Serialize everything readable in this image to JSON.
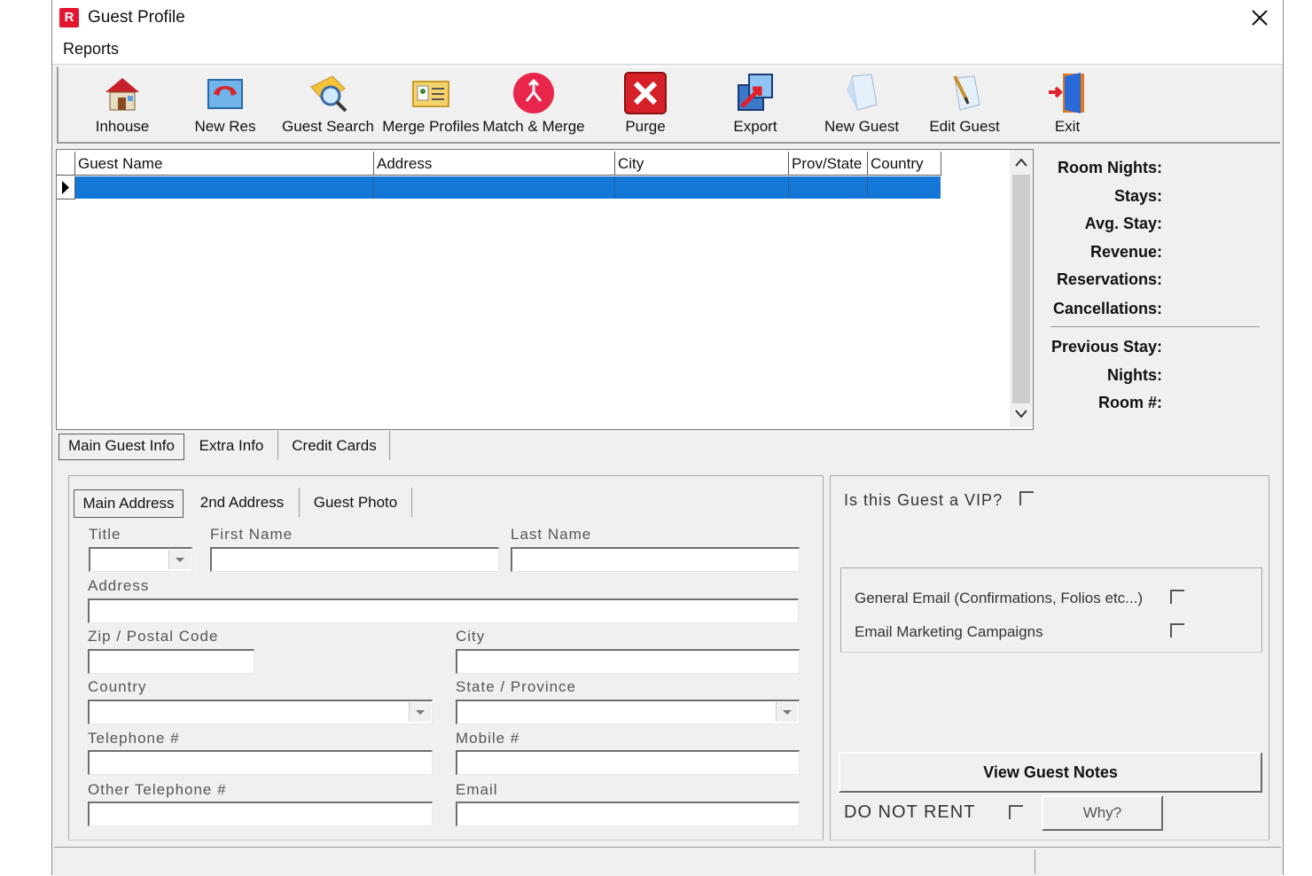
{
  "window": {
    "title": "Guest Profile",
    "logo_letter": "R"
  },
  "menu": {
    "reports": "Reports"
  },
  "toolbar": {
    "inhouse": "Inhouse",
    "new_res": "New Res",
    "guest_search": "Guest Search",
    "merge_profiles": "Merge Profiles",
    "match_merge": "Match & Merge",
    "purge": "Purge",
    "export": "Export",
    "new_guest": "New Guest",
    "edit_guest": "Edit Guest",
    "exit": "Exit"
  },
  "grid": {
    "columns": [
      "Guest Name",
      "Address",
      "City",
      "Prov/State",
      "Country"
    ]
  },
  "stats": {
    "room_nights": "Room Nights:",
    "stays": "Stays:",
    "avg_stay": "Avg. Stay:",
    "revenue": "Revenue:",
    "reservations": "Reservations:",
    "cancellations": "Cancellations:",
    "previous_stay": "Previous Stay:",
    "nights": "Nights:",
    "room_no": "Room #:"
  },
  "tabs": [
    "Main Guest Info",
    "Extra Info",
    "Credit Cards"
  ],
  "subtabs": [
    "Main Address",
    "2nd Address",
    "Guest Photo"
  ],
  "form": {
    "title": "Title",
    "first_name": "First Name",
    "last_name": "Last Name",
    "address": "Address",
    "zip": "Zip / Postal Code",
    "city": "City",
    "country": "Country",
    "state": "State / Province",
    "telephone": "Telephone #",
    "mobile": "Mobile #",
    "other_telephone": "Other Telephone #",
    "email": "Email"
  },
  "right": {
    "vip": "Is this Guest a VIP?",
    "general_email": "General Email (Confirmations, Folios etc...)",
    "email_marketing": "Email Marketing Campaigns",
    "view_notes": "View Guest Notes",
    "do_not_rent": "DO NOT RENT",
    "why": "Why?"
  },
  "colors": {
    "selection": "#1277d6",
    "logo": "#e3162f"
  }
}
